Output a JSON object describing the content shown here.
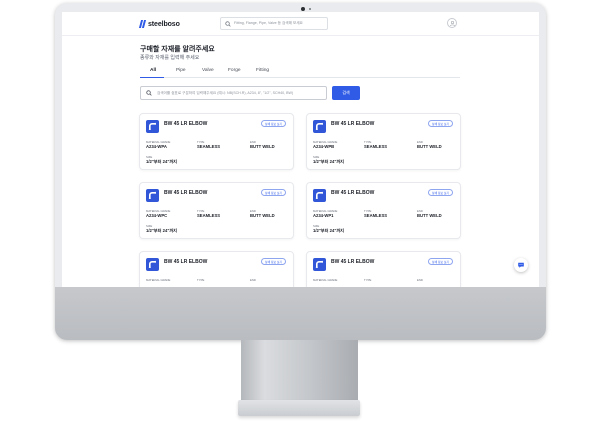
{
  "app": {
    "logo_text": "steelboso",
    "search_placeholder": "Fitting, Flange, Pipe, Valve 등 검색해 보세요"
  },
  "page": {
    "title": "구매할 자재를 알려주세요",
    "subtitle": "종류와 자재를 입력해 주세요"
  },
  "tabs": [
    {
      "label": "All",
      "active": true
    },
    {
      "label": "Pipe",
      "active": false
    },
    {
      "label": "Valve",
      "active": false
    },
    {
      "label": "Forge",
      "active": false
    },
    {
      "label": "Fitting",
      "active": false
    }
  ],
  "search": {
    "placeholder": "검색어를 쉼표로 구분하여 입력해주세요 (예시: NB(SCH.R), A234, 8\", \"1/2\", SCH40, BW)",
    "button_label": "검색"
  },
  "field_labels": {
    "grade": "MATERIAL GRADE",
    "type": "TYPE",
    "end": "END",
    "size": "SIZE"
  },
  "detail_button_label": "상세 정보 보기",
  "cards": [
    {
      "name": "BW 45 LR ELBOW",
      "grade": "A234-WPA",
      "type": "SEAMLESS",
      "end": "BUTT WELD",
      "size": "1/2\"부터 24\"까지"
    },
    {
      "name": "BW 45 LR ELBOW",
      "grade": "A234-WPB",
      "type": "SEAMLESS",
      "end": "BUTT WELD",
      "size": "1/2\"부터 24\"까지"
    },
    {
      "name": "BW 45 LR ELBOW",
      "grade": "A234-WPC",
      "type": "SEAMLESS",
      "end": "BUTT WELD",
      "size": "1/2\"부터 24\"까지"
    },
    {
      "name": "BW 45 LR ELBOW",
      "grade": "A234-WP1",
      "type": "SEAMLESS",
      "end": "BUTT WELD",
      "size": "1/2\"부터 24\"까지"
    },
    {
      "name": "BW 45 LR ELBOW",
      "grade": "",
      "type": "",
      "end": "",
      "size": ""
    },
    {
      "name": "BW 45 LR ELBOW",
      "grade": "",
      "type": "",
      "end": "",
      "size": ""
    }
  ],
  "colors": {
    "accent": "#2f5be7",
    "thumb": "#3157d8"
  },
  "icons": {
    "search": "search-icon",
    "user": "user-icon",
    "chat": "chat-icon",
    "product": "elbow-fitting-icon"
  }
}
